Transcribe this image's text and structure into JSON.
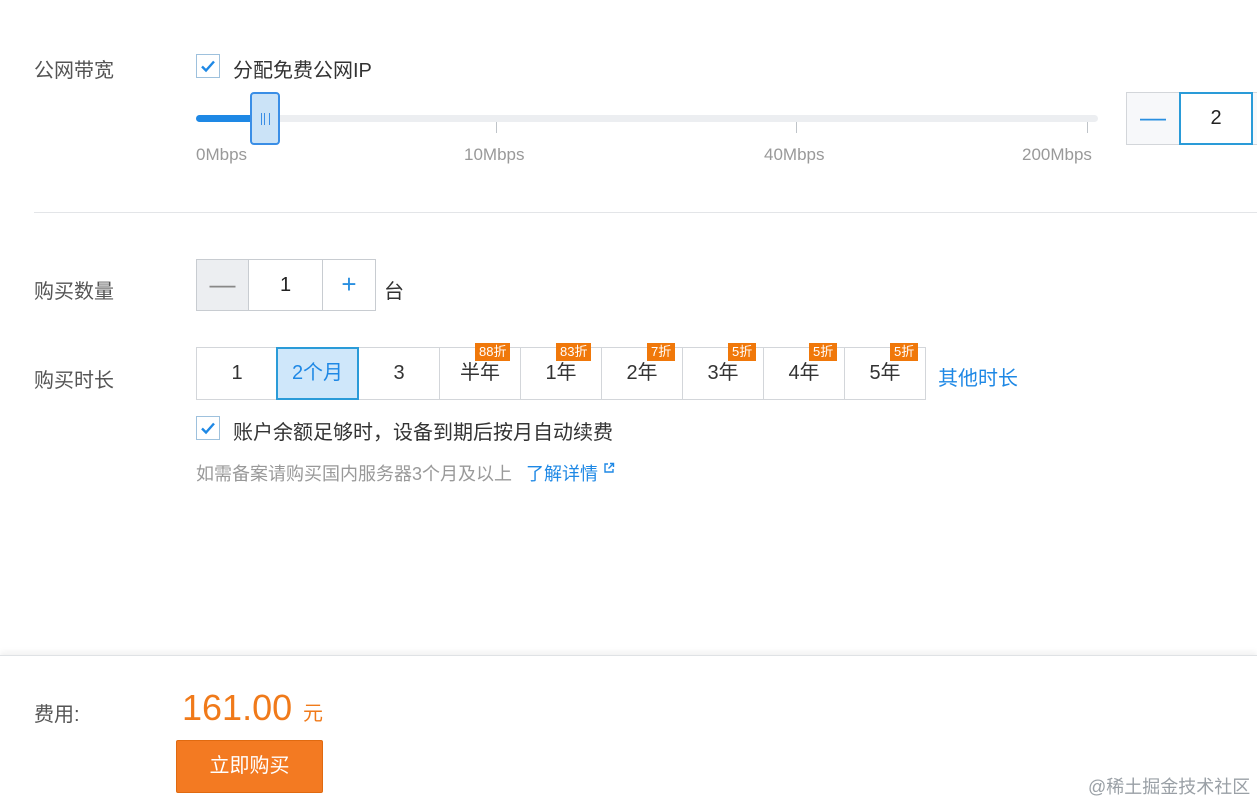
{
  "bandwidth": {
    "label": "公网带宽",
    "free_ip_label": "分配免费公网IP",
    "free_ip_checked": true,
    "slider_ticks": [
      "0Mbps",
      "10Mbps",
      "40Mbps",
      "200Mbps"
    ],
    "value": "2",
    "minus_symbol": "—"
  },
  "quantity": {
    "label": "购买数量",
    "value": "1",
    "unit": "台",
    "minus_symbol": "—",
    "plus_symbol": "+"
  },
  "duration": {
    "label": "购买时长",
    "options": [
      {
        "label": "1",
        "badge": ""
      },
      {
        "label": "2个月",
        "badge": ""
      },
      {
        "label": "3",
        "badge": ""
      },
      {
        "label": "半年",
        "badge": "88折"
      },
      {
        "label": "1年",
        "badge": "83折"
      },
      {
        "label": "2年",
        "badge": "7折"
      },
      {
        "label": "3年",
        "badge": "5折"
      },
      {
        "label": "4年",
        "badge": "5折"
      },
      {
        "label": "5年",
        "badge": "5折"
      }
    ],
    "selected": "2个月",
    "other_link": "其他时长",
    "auto_renew_label": "账户余额足够时，设备到期后按月自动续费",
    "auto_renew_checked": true,
    "note": "如需备案请购买国内服务器3个月及以上",
    "learn_more": "了解详情"
  },
  "footer": {
    "cost_label": "费用:",
    "price": "161.00",
    "currency": "元",
    "buy_button": "立即购买"
  },
  "watermark": "@稀土掘金技术社区",
  "colors": {
    "accent": "#1e88e5",
    "orange": "#f37a22",
    "badge": "#f0780a"
  }
}
